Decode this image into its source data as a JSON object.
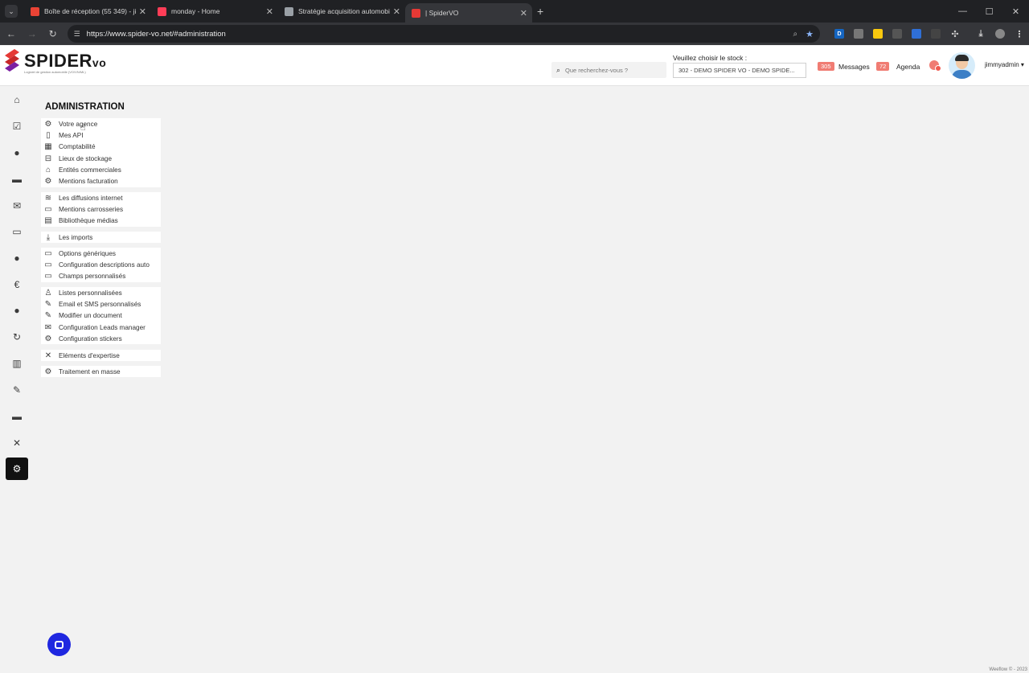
{
  "browser": {
    "tabs": [
      {
        "title": "Boîte de réception (55 349) - jim",
        "favicon_color": "#ea4335"
      },
      {
        "title": "monday - Home",
        "favicon_color": "#ff3d57"
      },
      {
        "title": "Stratégie acquisition automobil",
        "favicon_color": "#9aa0a6"
      },
      {
        "title": "| SpiderVO",
        "favicon_color": "#e53935"
      }
    ],
    "new_tab_icon": "+",
    "url": "https://www.spider-vo.net/#administration"
  },
  "header": {
    "logo_text": "SPIDER",
    "logo_suffix": "vo",
    "logo_tagline": "Logiciel de gestion automobile (VO/VN/ML)",
    "search_placeholder": "Que recherchez-vous ?",
    "stock_label": "Veuillez choisir le stock :",
    "stock_value": "302 - DEMO SPIDER VO - DEMO SPIDE...",
    "messages_count": "305",
    "messages_label": "Messages",
    "agenda_count": "72",
    "agenda_label": "Agenda",
    "username": "jimmyadmin",
    "accent_color": "#f07c73"
  },
  "leftnav": [
    {
      "name": "home-icon",
      "glyph": "⌂"
    },
    {
      "name": "calendar-check-icon",
      "glyph": "☑"
    },
    {
      "name": "user-circle-icon",
      "glyph": "●"
    },
    {
      "name": "briefcase-icon",
      "glyph": "▬"
    },
    {
      "name": "envelope-icon",
      "glyph": "✉"
    },
    {
      "name": "car-icon",
      "glyph": "▭"
    },
    {
      "name": "piggy-bank-icon",
      "glyph": "●"
    },
    {
      "name": "euro-icon",
      "glyph": "€"
    },
    {
      "name": "users-icon",
      "glyph": "●"
    },
    {
      "name": "sync-icon",
      "glyph": "↻"
    },
    {
      "name": "bar-chart-icon",
      "glyph": "▥"
    },
    {
      "name": "wrench-icon",
      "glyph": "✎"
    },
    {
      "name": "truck-icon",
      "glyph": "▬"
    },
    {
      "name": "tools-icon",
      "glyph": "✕"
    },
    {
      "name": "gear-icon",
      "glyph": "⚙"
    }
  ],
  "page": {
    "title": "ADMINISTRATION",
    "groups": [
      {
        "items": [
          {
            "label": "Votre agence",
            "icon": "gear-icon",
            "glyph": "⚙"
          },
          {
            "label": "Mes API",
            "icon": "mobile-icon",
            "glyph": "▯"
          },
          {
            "label": "Comptabilité",
            "icon": "calculator-icon",
            "glyph": "▦"
          },
          {
            "label": "Lieux de stockage",
            "icon": "parking-icon",
            "glyph": "⊟"
          },
          {
            "label": "Entités commerciales",
            "icon": "building-icon",
            "glyph": "⌂"
          },
          {
            "label": "Mentions facturation",
            "icon": "gear-icon",
            "glyph": "⚙"
          }
        ]
      },
      {
        "items": [
          {
            "label": "Les diffusions internet",
            "icon": "rss-icon",
            "glyph": "≋"
          },
          {
            "label": "Mentions carrosseries",
            "icon": "car-outline-icon",
            "glyph": "▭"
          },
          {
            "label": "Bibliothèque médias",
            "icon": "document-icon",
            "glyph": "▤"
          }
        ]
      },
      {
        "items": [
          {
            "label": "Les imports",
            "icon": "download-icon",
            "glyph": "⤓"
          }
        ]
      },
      {
        "items": [
          {
            "label": "Options génériques",
            "icon": "car-outline-icon",
            "glyph": "▭"
          },
          {
            "label": "Configuration descriptions auto",
            "icon": "car-outline-icon",
            "glyph": "▭"
          },
          {
            "label": "Champs personnalisés",
            "icon": "car-outline-icon",
            "glyph": "▭"
          }
        ]
      },
      {
        "items": [
          {
            "label": "Listes personnalisées",
            "icon": "user-list-icon",
            "glyph": "♙"
          },
          {
            "label": "Email et SMS personnalisés",
            "icon": "edit-icon",
            "glyph": "✎"
          },
          {
            "label": "Modifier un document",
            "icon": "edit-icon",
            "glyph": "✎"
          },
          {
            "label": "Configuration Leads manager",
            "icon": "envelope-icon",
            "glyph": "✉"
          },
          {
            "label": "Configuration stickers",
            "icon": "gear-icon",
            "glyph": "⚙"
          }
        ]
      },
      {
        "items": [
          {
            "label": "Eléments d'expertise",
            "icon": "tools-icon",
            "glyph": "✕"
          }
        ]
      },
      {
        "items": [
          {
            "label": "Traitement en masse",
            "icon": "gear-icon",
            "glyph": "⚙"
          }
        ]
      }
    ]
  },
  "footer": "Weeflow © - 2023"
}
